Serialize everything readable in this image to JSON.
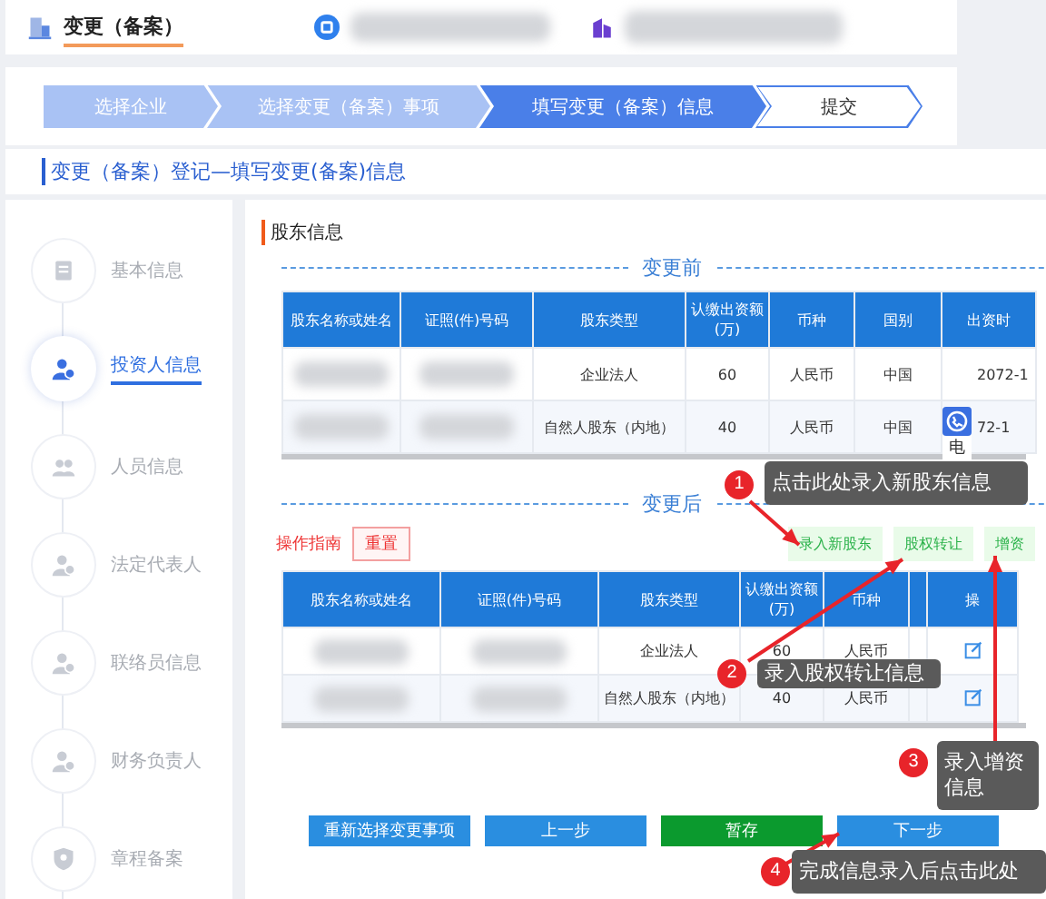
{
  "header": {
    "title": "变更（备案）"
  },
  "steps": [
    {
      "label": "选择企业",
      "completed": true,
      "selected": false
    },
    {
      "label": "选择变更（备案）事项",
      "completed": true,
      "selected": false
    },
    {
      "label": "填写变更（备案）信息",
      "completed": false,
      "selected": true
    },
    {
      "label": "提交",
      "completed": false,
      "selected": false
    }
  ],
  "section_title": "变更（备案）登记—填写变更(备案)信息",
  "sidebar": {
    "items": [
      {
        "label": "基本信息",
        "selected": false
      },
      {
        "label": "投资人信息",
        "selected": true
      },
      {
        "label": "人员信息",
        "selected": false
      },
      {
        "label": "法定代表人",
        "selected": false
      },
      {
        "label": "联络员信息",
        "selected": false
      },
      {
        "label": "财务负责人",
        "selected": false
      },
      {
        "label": "章程备案",
        "selected": false
      }
    ]
  },
  "panel_title": "股东信息",
  "before": {
    "divider": "变更前",
    "columns": [
      "股东名称或姓名",
      "证照(件)号码",
      "股东类型",
      "认缴出资额(万)",
      "币种",
      "国别",
      "出资时"
    ],
    "rows": [
      {
        "type": "企业法人",
        "amount": "60",
        "currency": "人民币",
        "country": "中国",
        "date": "2072-1"
      },
      {
        "type": "自然人股东（内地）",
        "amount": "40",
        "currency": "人民币",
        "country": "中国",
        "date": "72-1"
      }
    ]
  },
  "contact_widget": {
    "label": "电"
  },
  "after": {
    "divider": "变更后",
    "guide": "操作指南",
    "reset": "重置",
    "actions": [
      "录入新股东",
      "股权转让",
      "增资"
    ],
    "columns": [
      "股东名称或姓名",
      "证照(件)号码",
      "股东类型",
      "认缴出资额(万)",
      "币种",
      "",
      "操"
    ],
    "rows": [
      {
        "type": "企业法人",
        "amount": "60",
        "currency": "人民币"
      },
      {
        "type": "自然人股东（内地）",
        "amount": "40",
        "currency": "人民币"
      }
    ]
  },
  "buttons": [
    {
      "label": "重新选择变更事项",
      "kind": "primary"
    },
    {
      "label": "上一步",
      "kind": "primary"
    },
    {
      "label": "暂存",
      "kind": "save"
    },
    {
      "label": "下一步",
      "kind": "primary"
    }
  ],
  "callouts": [
    {
      "number": "1",
      "text": "点击此处录入新股东信息"
    },
    {
      "number": "2",
      "text": "录入股权转让信息"
    },
    {
      "number": "3",
      "text": "录入增资信息"
    },
    {
      "number": "4",
      "text": "完成信息录入后点击此处"
    }
  ]
}
